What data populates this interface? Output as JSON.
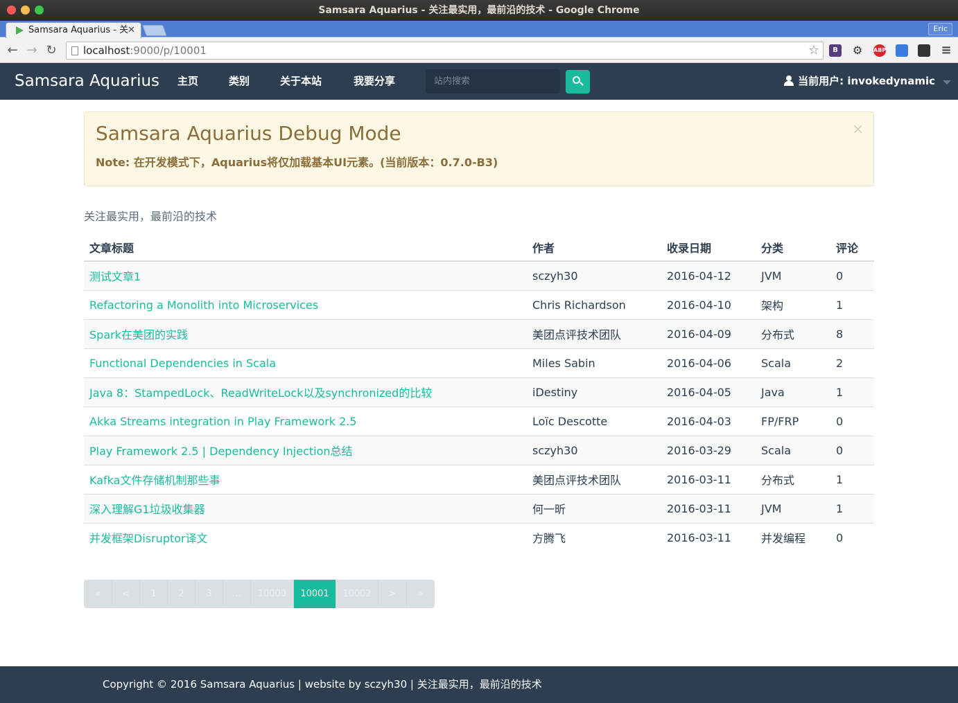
{
  "window": {
    "title": "Samsara Aquarius - 关注最实用，最前沿的技术 - Google Chrome",
    "tab_title": "Samsara Aquarius - 关",
    "profile": "Eric"
  },
  "address_bar": {
    "host": "localhost",
    "path": ":9000/p/10001"
  },
  "extensions": [
    {
      "name": "bootstrap-icon",
      "label": "B",
      "color": "#563d7c"
    },
    {
      "name": "gear-icon",
      "label": "⚙",
      "color": "#ffffff"
    },
    {
      "name": "adblock-icon",
      "label": "ABP",
      "color": "#e0212a"
    },
    {
      "name": "calendar-icon",
      "label": "",
      "color": "#3b7ddd"
    },
    {
      "name": "incognito-icon",
      "label": "",
      "color": "#333333"
    },
    {
      "name": "menu-icon",
      "label": "≡",
      "color": "#ffffff"
    }
  ],
  "navbar": {
    "brand": "Samsara Aquarius",
    "links": [
      "主页",
      "类别",
      "关于本站",
      "我要分享"
    ],
    "search_placeholder": "站内搜索",
    "user": "当前用户: invokedynamic"
  },
  "alert": {
    "title": "Samsara Aquarius Debug Mode",
    "message": "Note: 在开发模式下，Aquarius将仅加载基本UI元素。(当前版本：0.7.0-B3)",
    "close": "×"
  },
  "tagline": "关注最实用，最前沿的技术",
  "table": {
    "headers": [
      "文章标题",
      "作者",
      "收录日期",
      "分类",
      "评论"
    ],
    "rows": [
      {
        "title": "测试文章1",
        "author": "sczyh30",
        "date": "2016-04-12",
        "category": "JVM",
        "comments": "0"
      },
      {
        "title": "Refactoring a Monolith into Microservices",
        "author": "Chris Richardson",
        "date": "2016-04-10",
        "category": "架构",
        "comments": "1"
      },
      {
        "title": "Spark在美团的实践",
        "author": "美团点评技术团队",
        "date": "2016-04-09",
        "category": "分布式",
        "comments": "8"
      },
      {
        "title": "Functional Dependencies in Scala",
        "author": "Miles Sabin",
        "date": "2016-04-06",
        "category": "Scala",
        "comments": "2"
      },
      {
        "title": "Java 8：StampedLock、ReadWriteLock以及synchronized的比较",
        "author": "iDestiny",
        "date": "2016-04-05",
        "category": "Java",
        "comments": "1"
      },
      {
        "title": "Akka Streams integration in Play Framework 2.5",
        "author": "Loïc Descotte",
        "date": "2016-04-03",
        "category": "FP/FRP",
        "comments": "0"
      },
      {
        "title": "Play Framework 2.5 | Dependency Injection总结",
        "author": "sczyh30",
        "date": "2016-03-29",
        "category": "Scala",
        "comments": "0"
      },
      {
        "title": "Kafka文件存储机制那些事",
        "author": "美团点评技术团队",
        "date": "2016-03-11",
        "category": "分布式",
        "comments": "1"
      },
      {
        "title": "深入理解G1垃圾收集器",
        "author": "何一昕",
        "date": "2016-03-11",
        "category": "JVM",
        "comments": "1"
      },
      {
        "title": "并发框架Disruptor译文",
        "author": "方腾飞",
        "date": "2016-03-11",
        "category": "并发编程",
        "comments": "0"
      }
    ]
  },
  "pagination": {
    "items": [
      {
        "label": "«",
        "state": "disabled"
      },
      {
        "label": "<",
        "state": "disabled"
      },
      {
        "label": "1",
        "state": "disabled"
      },
      {
        "label": "2",
        "state": "disabled"
      },
      {
        "label": "3",
        "state": "disabled"
      },
      {
        "label": "...",
        "state": "disabled"
      },
      {
        "label": "10000",
        "state": "disabled"
      },
      {
        "label": "10001",
        "state": "active"
      },
      {
        "label": "10002",
        "state": "disabled"
      },
      {
        "label": ">",
        "state": "disabled"
      },
      {
        "label": "»",
        "state": "disabled"
      }
    ],
    "active_color": "#18bc9c"
  },
  "footer": {
    "text": "Copyright © 2016 Samsara Aquarius | website by sczyh30 | 关注最实用，最前沿的技术"
  }
}
